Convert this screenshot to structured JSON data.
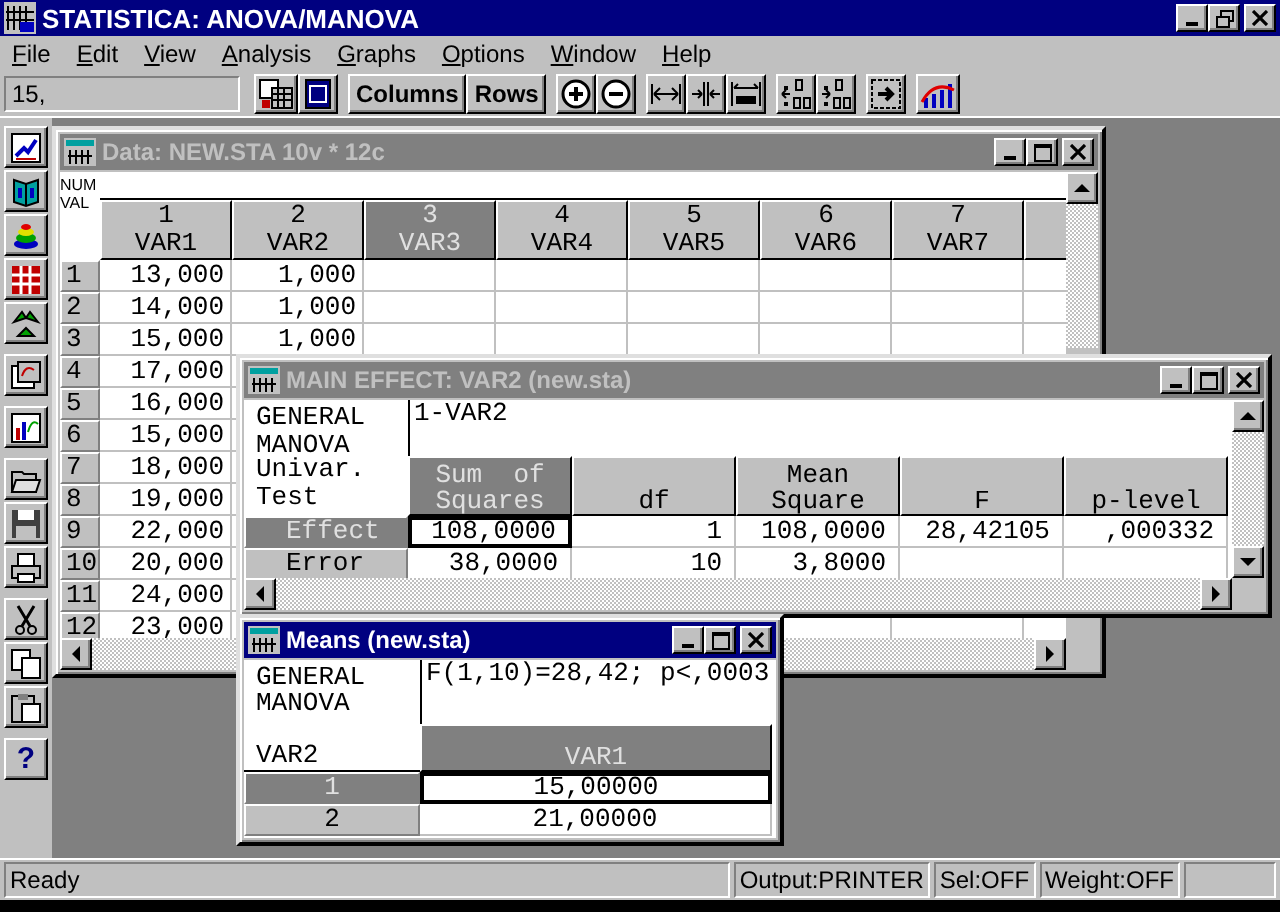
{
  "window": {
    "title": "STATISTICA: ANOVA/MANOVA"
  },
  "menu": [
    "File",
    "Edit",
    "View",
    "Analysis",
    "Graphs",
    "Options",
    "Window",
    "Help"
  ],
  "toolbar": {
    "field_value": "15,",
    "text_buttons": [
      "Columns",
      "Rows"
    ]
  },
  "side_toolbar": {
    "help": "?"
  },
  "data_window": {
    "title": "Data: NEW.STA 10v * 12c",
    "active": false,
    "corner_labels": [
      "NUM",
      "VAL"
    ],
    "columns": [
      {
        "number": "1",
        "name": "VAR1",
        "selected": false
      },
      {
        "number": "2",
        "name": "VAR2",
        "selected": false
      },
      {
        "number": "3",
        "name": "VAR3",
        "selected": true
      },
      {
        "number": "4",
        "name": "VAR4",
        "selected": false
      },
      {
        "number": "5",
        "name": "VAR5",
        "selected": false
      },
      {
        "number": "6",
        "name": "VAR6",
        "selected": false
      },
      {
        "number": "7",
        "name": "VAR7",
        "selected": false
      }
    ],
    "rows": [
      {
        "label": "1",
        "cells": [
          "13,000",
          "1,000"
        ]
      },
      {
        "label": "2",
        "cells": [
          "14,000",
          "1,000"
        ]
      },
      {
        "label": "3",
        "cells": [
          "15,000",
          "1,000"
        ]
      },
      {
        "label": "4",
        "cells": [
          "17,000"
        ]
      },
      {
        "label": "5",
        "cells": [
          "16,000"
        ]
      },
      {
        "label": "6",
        "cells": [
          "15,000"
        ]
      },
      {
        "label": "7",
        "cells": [
          "18,000"
        ]
      },
      {
        "label": "8",
        "cells": [
          "19,000"
        ]
      },
      {
        "label": "9",
        "cells": [
          "22,000"
        ]
      },
      {
        "label": "10",
        "cells": [
          "20,000"
        ]
      },
      {
        "label": "11",
        "cells": [
          "24,000"
        ]
      },
      {
        "label": "12",
        "cells": [
          "23,000"
        ]
      }
    ]
  },
  "effect_window": {
    "title": "MAIN EFFECT: VAR2 (new.sta)",
    "active": false,
    "panel_title": [
      "GENERAL",
      "MANOVA"
    ],
    "panel_subtitle": [
      "Univar.",
      "Test"
    ],
    "caption": "1-VAR2",
    "columns": [
      {
        "lines": [
          "Sum  of",
          "Squares"
        ],
        "selected": true
      },
      {
        "lines": [
          "df"
        ],
        "selected": false
      },
      {
        "lines": [
          "Mean",
          "Square"
        ],
        "selected": false
      },
      {
        "lines": [
          "F"
        ],
        "selected": false
      },
      {
        "lines": [
          "p-level"
        ],
        "selected": false
      }
    ],
    "rows": [
      {
        "label": "Effect",
        "selected": true,
        "cells": [
          {
            "text": "108,0000",
            "focused": true
          },
          {
            "text": "1",
            "focused": false
          },
          {
            "text": "108,0000",
            "focused": false
          },
          {
            "text": "28,42105",
            "focused": false
          },
          {
            "text": ",000332",
            "focused": false
          }
        ]
      },
      {
        "label": "Error",
        "selected": false,
        "cells": [
          {
            "text": "38,0000",
            "focused": false
          },
          {
            "text": "10",
            "focused": false
          },
          {
            "text": "3,8000",
            "focused": false
          }
        ]
      }
    ]
  },
  "means_window": {
    "title": "Means (new.sta)",
    "active": true,
    "panel_title": [
      "GENERAL",
      "MANOVA"
    ],
    "factor": "VAR2",
    "caption": "F(1,10)=28,42; p<,0003",
    "columns": [
      {
        "lines": [
          "VAR1"
        ],
        "selected": true
      }
    ],
    "rows": [
      {
        "label": "1",
        "selected": true,
        "cells": [
          {
            "text": "15,00000",
            "focused": true
          }
        ]
      },
      {
        "label": "2",
        "selected": false,
        "cells": [
          {
            "text": "21,00000",
            "focused": false
          }
        ]
      }
    ]
  },
  "status_bar": [
    "Ready",
    "Output:PRINTER",
    "Sel:OFF",
    "Weight:OFF"
  ]
}
